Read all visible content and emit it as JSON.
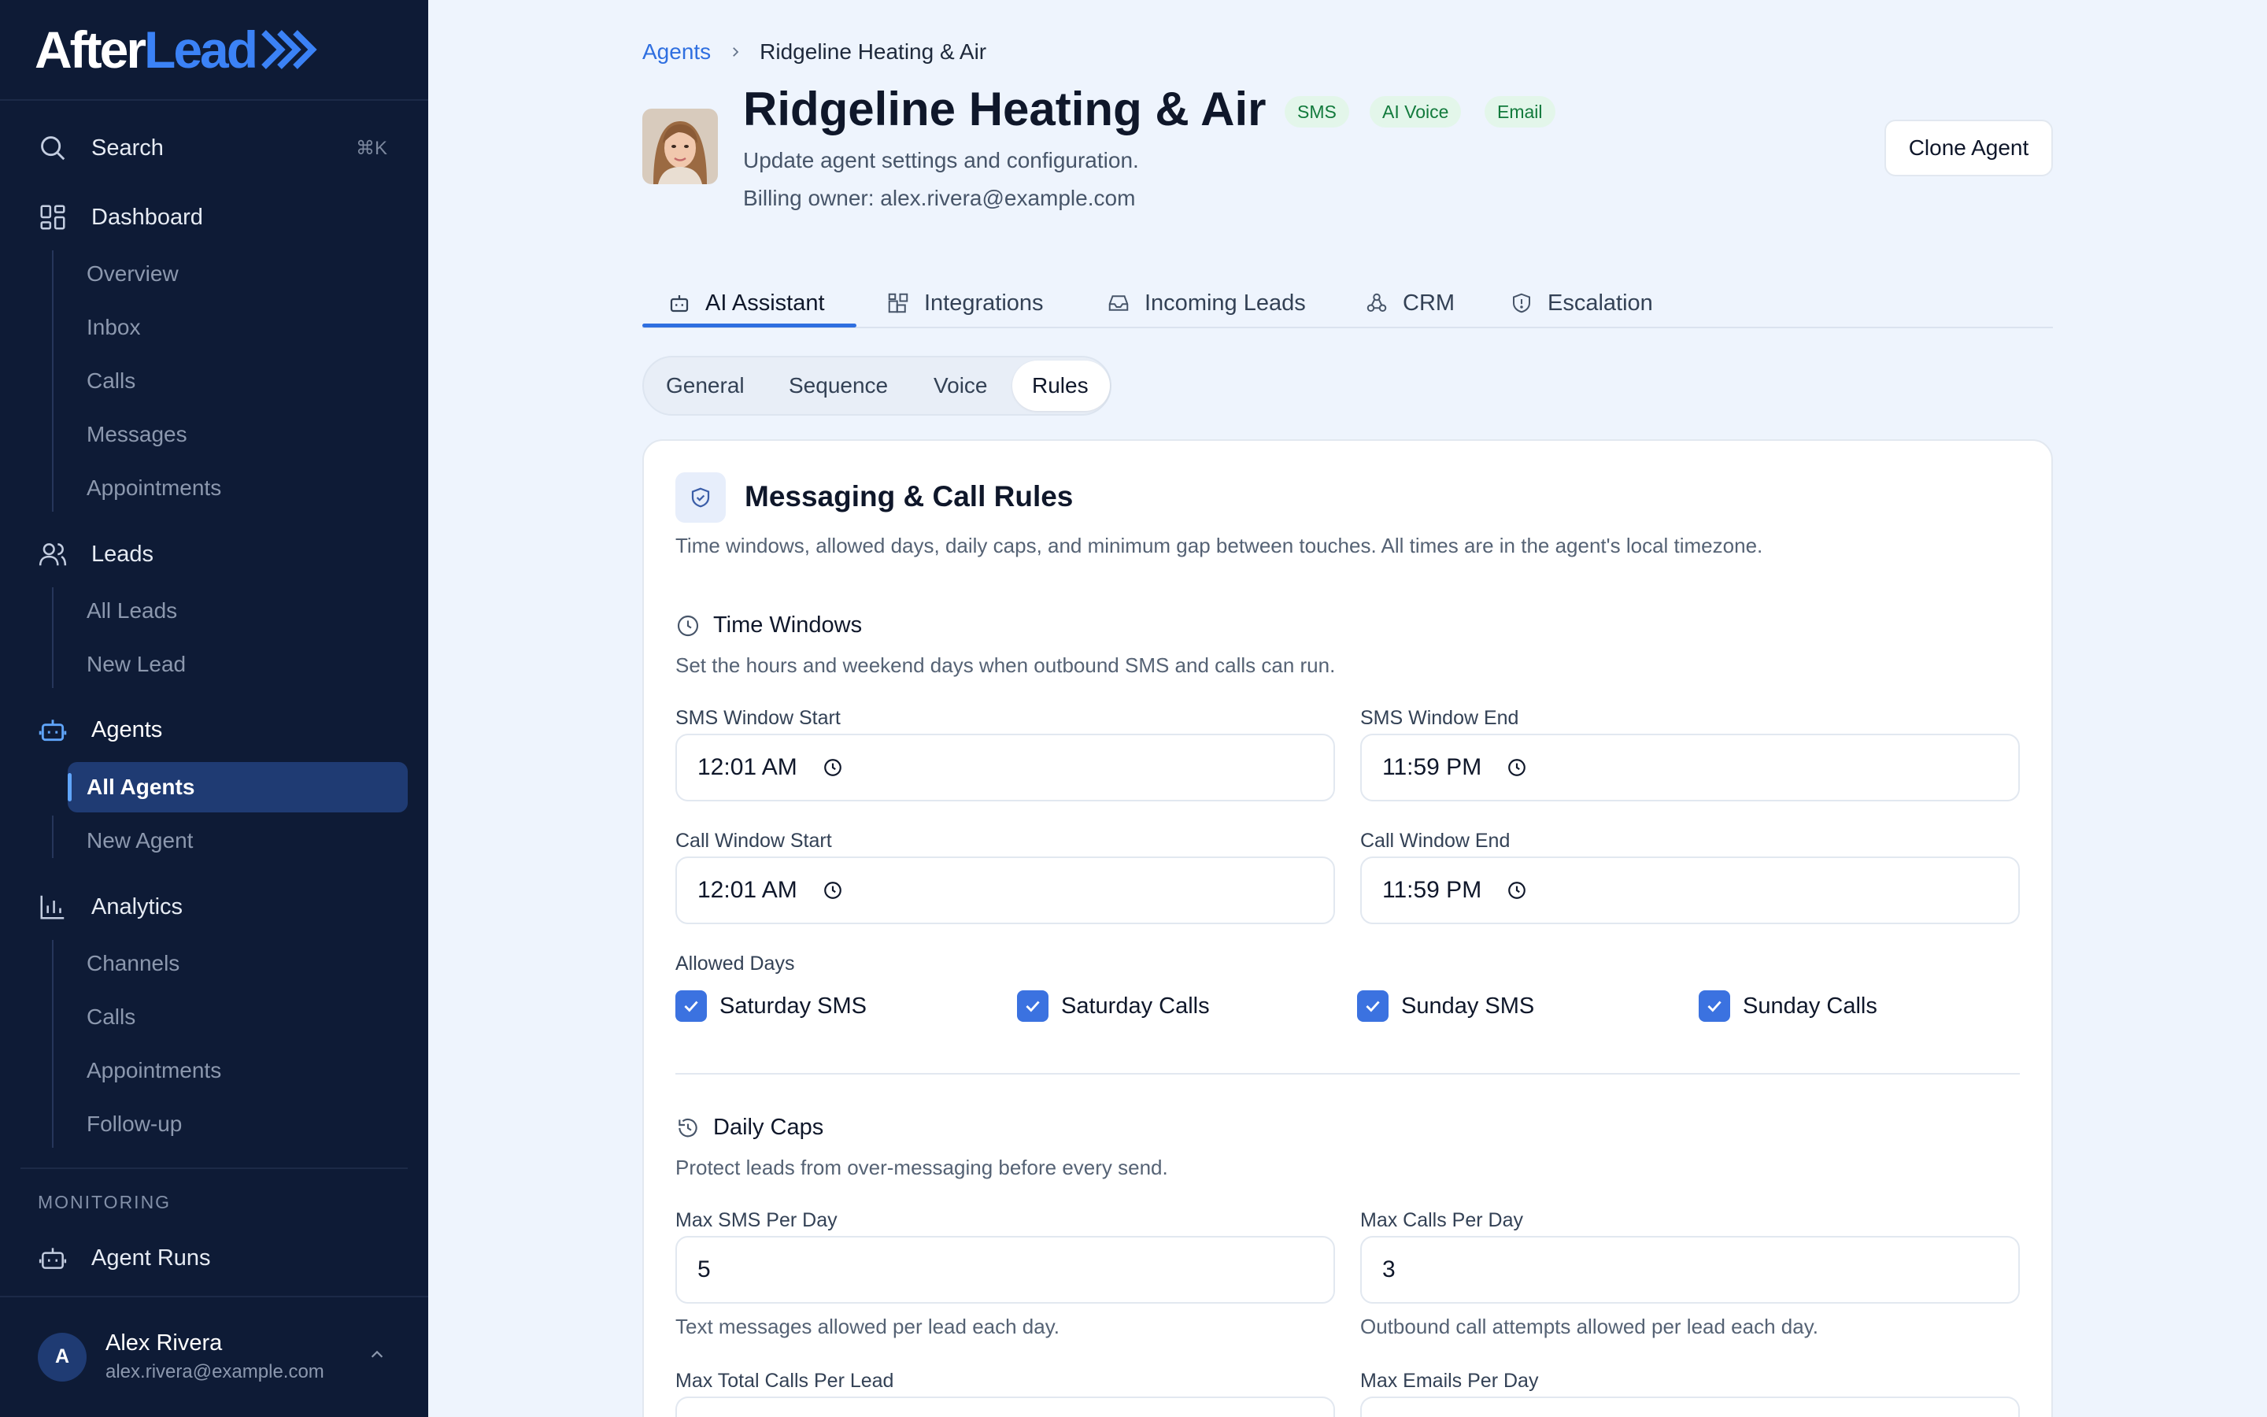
{
  "brand": {
    "part1": "After",
    "part2": "Lead"
  },
  "sidebar": {
    "search_label": "Search",
    "search_shortcut": "⌘K",
    "dashboard": {
      "label": "Dashboard",
      "items": [
        "Overview",
        "Inbox",
        "Calls",
        "Messages",
        "Appointments"
      ]
    },
    "leads": {
      "label": "Leads",
      "items": [
        "All Leads",
        "New Lead"
      ]
    },
    "agents": {
      "label": "Agents",
      "items": [
        "All Agents",
        "New Agent"
      ]
    },
    "analytics": {
      "label": "Analytics",
      "items": [
        "Channels",
        "Calls",
        "Appointments",
        "Follow-up"
      ]
    },
    "monitoring_label": "MONITORING",
    "agent_runs": "Agent Runs",
    "user": {
      "initial": "A",
      "name": "Alex Rivera",
      "email": "alex.rivera@example.com"
    }
  },
  "breadcrumb": {
    "parent": "Agents",
    "current": "Ridgeline Heating & Air"
  },
  "header": {
    "title": "Ridgeline Heating & Air",
    "badges": [
      "SMS",
      "AI Voice",
      "Email"
    ],
    "subtitle": "Update agent settings and configuration.",
    "billing": "Billing owner: alex.rivera@example.com",
    "clone_label": "Clone Agent"
  },
  "tabs": [
    "AI Assistant",
    "Integrations",
    "Incoming Leads",
    "CRM",
    "Escalation"
  ],
  "subtabs": [
    "General",
    "Sequence",
    "Voice",
    "Rules"
  ],
  "card": {
    "title": "Messaging & Call Rules",
    "description": "Time windows, allowed days, daily caps, and minimum gap between touches. All times are in the agent's local timezone.",
    "time_windows": {
      "title": "Time Windows",
      "description": "Set the hours and weekend days when outbound SMS and calls can run.",
      "sms_start": {
        "label": "SMS Window Start",
        "value": "12:01 AM"
      },
      "sms_end": {
        "label": "SMS Window End",
        "value": "11:59 PM"
      },
      "call_start": {
        "label": "Call Window Start",
        "value": "12:01 AM"
      },
      "call_end": {
        "label": "Call Window End",
        "value": "11:59 PM"
      },
      "allowed_days_label": "Allowed Days",
      "days": [
        "Saturday SMS",
        "Saturday Calls",
        "Sunday SMS",
        "Sunday Calls"
      ]
    },
    "daily_caps": {
      "title": "Daily Caps",
      "description": "Protect leads from over-messaging before every send.",
      "max_sms": {
        "label": "Max SMS Per Day",
        "value": "5",
        "help": "Text messages allowed per lead each day."
      },
      "max_calls": {
        "label": "Max Calls Per Day",
        "value": "3",
        "help": "Outbound call attempts allowed per lead each day."
      },
      "max_total_calls_label": "Max Total Calls Per Lead",
      "max_emails_label": "Max Emails Per Day"
    }
  },
  "colors": {
    "sidebar_bg": "#0e1b36",
    "accent": "#2f6fe0",
    "badge_text": "#127a3c",
    "page_bg": "#eef4fd"
  }
}
